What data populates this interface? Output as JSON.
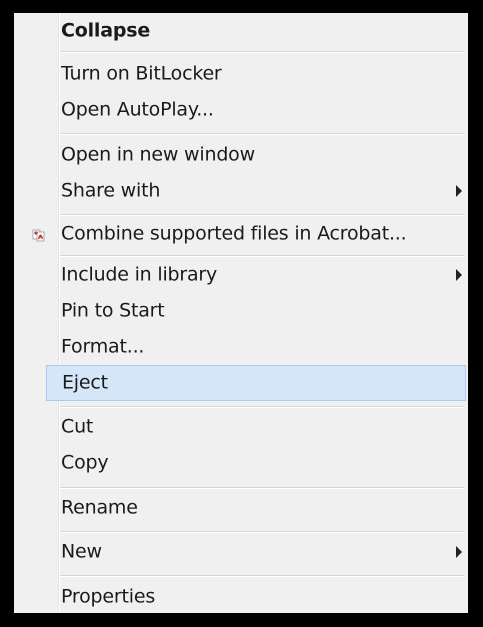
{
  "menu": {
    "items": [
      {
        "label": "Collapse"
      },
      {
        "label": "Turn on BitLocker"
      },
      {
        "label": "Open AutoPlay..."
      },
      {
        "label": "Open in new window"
      },
      {
        "label": "Share with"
      },
      {
        "label": "Combine supported files in Acrobat..."
      },
      {
        "label": "Include in library"
      },
      {
        "label": "Pin to Start"
      },
      {
        "label": "Format..."
      },
      {
        "label": "Eject"
      },
      {
        "label": "Cut"
      },
      {
        "label": "Copy"
      },
      {
        "label": "Rename"
      },
      {
        "label": "New"
      },
      {
        "label": "Properties"
      }
    ],
    "highlighted_item": "Eject",
    "icons": {
      "combine_acrobat": "acrobat-icon",
      "submenu": "chevron-right-icon"
    },
    "colors": {
      "background": "#f0f0f0",
      "highlight": "#d5e6f8",
      "highlight_border": "#a8caef",
      "acrobat_icon": "#c0392b"
    }
  }
}
